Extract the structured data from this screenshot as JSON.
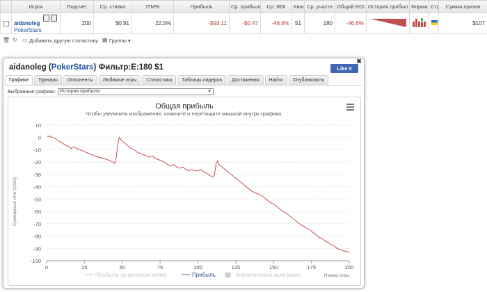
{
  "table": {
    "headers": [
      "",
      "Игрок",
      "Подсчет",
      "Ср. ставка",
      "ITM%",
      "Прибыль",
      "Ср. прибыль",
      "Ср. ROI",
      "Квал",
      "Ср. участн",
      "Общий ROI",
      "История прибыл",
      "Форма",
      "Стр",
      "Сумма призов"
    ],
    "row": {
      "player_name": "aidanoleg",
      "player_site": "PokerStars",
      "count": "200",
      "avg_stake": "$0.91",
      "itm": "22.5%",
      "profit": "-$93.11",
      "avg_profit": "-$0.47",
      "avg_roi": "-46.6%",
      "qual": "51",
      "avg_field": "180",
      "total_roi": "-46.6%",
      "prize_sum": "$107"
    }
  },
  "toolbar": {
    "add_stats_label": "Добавить другую статистику",
    "groups_label": "Группы"
  },
  "popup": {
    "title_player": "aidanoleg",
    "title_site": "PokerStars",
    "title_filter": "Фильтр:E:180 $1",
    "fb_like": "Like 0",
    "tabs": [
      "Графики",
      "Турниры",
      "Оппоненты",
      "Любимые игры",
      "Статистика",
      "Таблицы лидеров",
      "Достижения",
      "Найти",
      "Опубликовать"
    ],
    "select_label": "Выбранные графики:",
    "select_value": "История прибыли"
  },
  "chart_data": {
    "type": "line",
    "title": "Общая прибыль",
    "subtitle": "Чтобы увеличить изображение, кликните и перетащите мышкой внутрь графика.",
    "xlabel": "Номер игры",
    "ylabel": "Суммарный итог (USD)",
    "xlim": [
      0,
      200
    ],
    "ylim": [
      -100,
      10
    ],
    "x_ticks": [
      0,
      25,
      50,
      75,
      100,
      125,
      150,
      175,
      200
    ],
    "y_ticks": [
      10,
      0,
      -10,
      -20,
      -30,
      -40,
      -50,
      -60,
      -70,
      -80,
      -90,
      -100
    ],
    "grid": true,
    "series": [
      {
        "name": "Прибыль",
        "color": "#c0504d",
        "points": [
          [
            0,
            1
          ],
          [
            2,
            1
          ],
          [
            4,
            0
          ],
          [
            6,
            -1
          ],
          [
            8,
            -3
          ],
          [
            10,
            -4
          ],
          [
            12,
            -6
          ],
          [
            14,
            -7
          ],
          [
            16,
            -9
          ],
          [
            18,
            -7.5
          ],
          [
            20,
            -9
          ],
          [
            22,
            -10
          ],
          [
            24,
            -11
          ],
          [
            26,
            -12
          ],
          [
            28,
            -13
          ],
          [
            30,
            -14
          ],
          [
            32,
            -15
          ],
          [
            34,
            -16
          ],
          [
            36,
            -16.5
          ],
          [
            38,
            -17
          ],
          [
            40,
            -18
          ],
          [
            42,
            -19
          ],
          [
            44,
            -20
          ],
          [
            45,
            -21
          ],
          [
            46,
            -16
          ],
          [
            47,
            -6
          ],
          [
            48,
            0
          ],
          [
            50,
            -3
          ],
          [
            52,
            -5
          ],
          [
            54,
            -7
          ],
          [
            56,
            -9
          ],
          [
            58,
            -10
          ],
          [
            60,
            -12
          ],
          [
            62,
            -13
          ],
          [
            64,
            -14
          ],
          [
            66,
            -15
          ],
          [
            68,
            -16
          ],
          [
            70,
            -15
          ],
          [
            72,
            -17
          ],
          [
            74,
            -18
          ],
          [
            76,
            -19
          ],
          [
            78,
            -20
          ],
          [
            80,
            -22
          ],
          [
            82,
            -23
          ],
          [
            84,
            -22
          ],
          [
            86,
            -24
          ],
          [
            88,
            -25
          ],
          [
            90,
            -24
          ],
          [
            92,
            -26
          ],
          [
            94,
            -27
          ],
          [
            96,
            -26
          ],
          [
            98,
            -27
          ],
          [
            100,
            -27
          ],
          [
            102,
            -26
          ],
          [
            104,
            -28
          ],
          [
            106,
            -29
          ],
          [
            108,
            -31
          ],
          [
            110,
            -32
          ],
          [
            111,
            -30
          ],
          [
            112,
            -21
          ],
          [
            113,
            -19
          ],
          [
            114,
            -22
          ],
          [
            116,
            -24
          ],
          [
            118,
            -26
          ],
          [
            120,
            -28
          ],
          [
            122,
            -30
          ],
          [
            124,
            -32
          ],
          [
            126,
            -34
          ],
          [
            128,
            -36
          ],
          [
            130,
            -38
          ],
          [
            132,
            -40
          ],
          [
            134,
            -42
          ],
          [
            136,
            -44
          ],
          [
            138,
            -45
          ],
          [
            140,
            -46
          ],
          [
            142,
            -47
          ],
          [
            144,
            -49
          ],
          [
            146,
            -51
          ],
          [
            148,
            -53
          ],
          [
            150,
            -54
          ],
          [
            152,
            -56
          ],
          [
            154,
            -58
          ],
          [
            156,
            -60
          ],
          [
            158,
            -61
          ],
          [
            160,
            -63
          ],
          [
            162,
            -65
          ],
          [
            164,
            -67
          ],
          [
            166,
            -69
          ],
          [
            168,
            -71
          ],
          [
            170,
            -72
          ],
          [
            172,
            -74
          ],
          [
            174,
            -75
          ],
          [
            176,
            -77
          ],
          [
            178,
            -79
          ],
          [
            180,
            -81
          ],
          [
            182,
            -82
          ],
          [
            184,
            -84
          ],
          [
            186,
            -85
          ],
          [
            188,
            -87
          ],
          [
            190,
            -88
          ],
          [
            192,
            -90
          ],
          [
            194,
            -91
          ],
          [
            196,
            -92
          ],
          [
            198,
            -92.5
          ],
          [
            200,
            -93
          ]
        ]
      }
    ],
    "legend": [
      "Прибыль за минусом рейка",
      "Прибыль",
      "Значительные выигрыши"
    ],
    "legend_colors": [
      "#cccccc",
      "#4a6da7",
      "#cccccc"
    ],
    "legend_placement": "bottom"
  }
}
